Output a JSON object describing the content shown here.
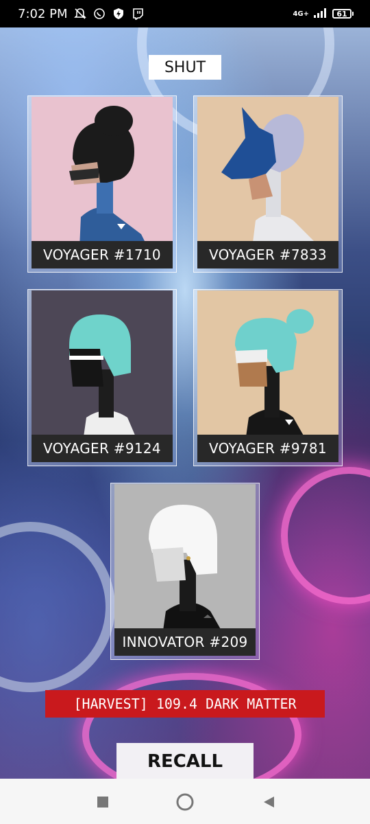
{
  "status_bar": {
    "time": "7:02 PM",
    "network": "4G+",
    "battery": "61",
    "icons": [
      "bell-off-icon",
      "whatsapp-icon",
      "shield-bolt-icon",
      "twitch-icon"
    ]
  },
  "header": {
    "shut_label": "SHUT"
  },
  "cards": [
    {
      "label": "VOYAGER #1710",
      "bg": "#e9c2cf",
      "hair": "#1b1b1b",
      "visor": "#2a2a2a",
      "suit": "#2f5d9a",
      "has_badge": true
    },
    {
      "label": "VOYAGER #7833",
      "bg": "#e3c6a6",
      "hair": "#b7b9d8",
      "visor": "#1f4f96",
      "suit": "#e9e9ec",
      "has_badge": false
    },
    {
      "label": "VOYAGER #9124",
      "bg": "#4d4756",
      "hair": "#6fd3cb",
      "visor": "#151515",
      "suit": "#eeeeee",
      "has_badge": false
    },
    {
      "label": "VOYAGER #9781",
      "bg": "#e2c6a4",
      "hair": "#6fd0cc",
      "visor": "#efefef",
      "suit": "#161616",
      "has_badge": true
    },
    {
      "label": "INNOVATOR #209",
      "bg": "#b6b6b6",
      "hair": "#f7f7f7",
      "visor": "#dcdcdc",
      "suit": "#111111",
      "has_badge": false
    }
  ],
  "banner": {
    "text": "[HARVEST] 109.4 DARK MATTER"
  },
  "footer": {
    "recall_label": "RECALL"
  },
  "nav": {
    "icons": [
      "square-icon",
      "circle-home-icon",
      "triangle-back-icon"
    ]
  },
  "colors": {
    "banner_red": "#c9191d",
    "label_bg": "#282828"
  }
}
